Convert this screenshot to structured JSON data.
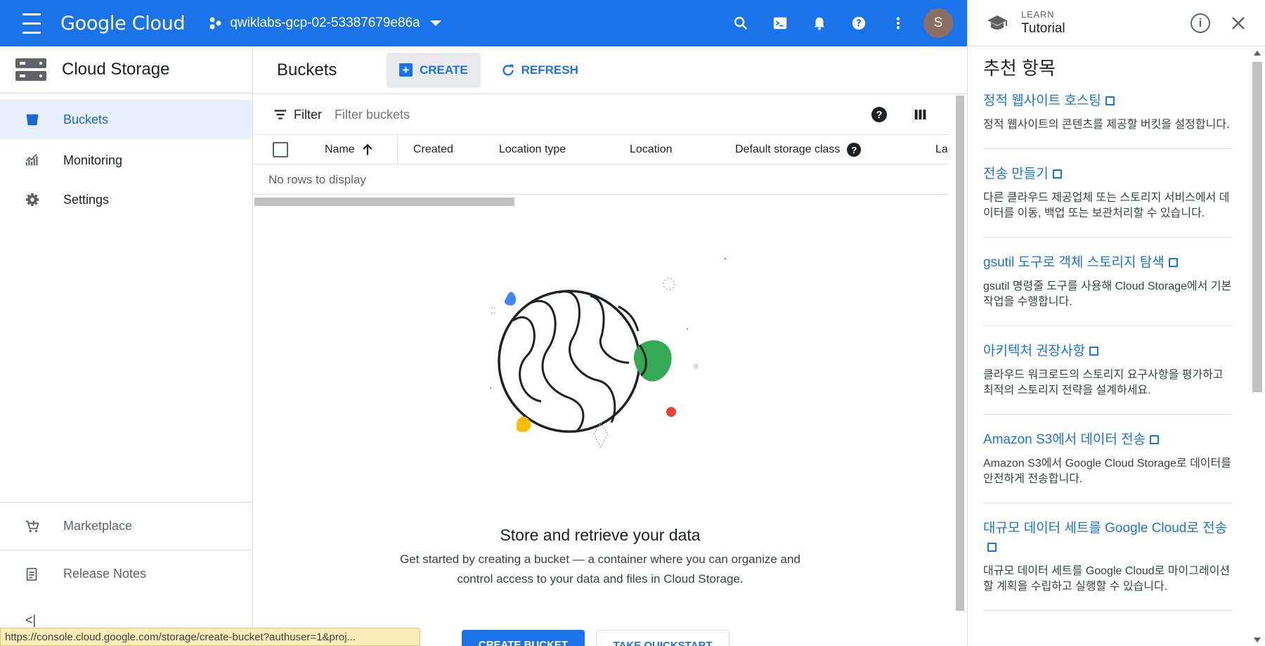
{
  "topbar": {
    "logo": "Google Cloud",
    "project": "qwiklabs-gcp-02-53387679e86a",
    "avatar_initial": "S",
    "bar_color": "#1a73e8"
  },
  "leftnav": {
    "product_title": "Cloud Storage",
    "items": [
      {
        "label": "Buckets",
        "icon": "bucket-icon",
        "active": true
      },
      {
        "label": "Monitoring",
        "icon": "monitoring-icon"
      },
      {
        "label": "Settings",
        "icon": "gear-icon"
      }
    ],
    "bottom_items": [
      {
        "label": "Marketplace",
        "icon": "marketplace-cart-icon"
      },
      {
        "label": "Release Notes",
        "icon": "release-notes-icon"
      }
    ],
    "collapse_glyph": "<|"
  },
  "main": {
    "page_title": "Buckets",
    "create_label": "CREATE",
    "refresh_label": "REFRESH",
    "filter_label": "Filter",
    "filter_placeholder": "Filter buckets",
    "columns": [
      "Name",
      "Created",
      "Location type",
      "Location",
      "Default storage class",
      "La"
    ],
    "no_rows": "No rows to display",
    "empty_title": "Store and retrieve your data",
    "empty_desc_line1": "Get started by creating a bucket — a container where you can organize and",
    "empty_desc_line2": "control access to your data and files in Cloud Storage.",
    "create_bucket_label": "CREATE BUCKET",
    "quickstart_label": "TAKE QUICKSTART"
  },
  "status_url": "https://console.cloud.google.com/storage/create-bucket?authuser=1&proj...",
  "rpanel": {
    "learn_label": "LEARN",
    "tutorial_label": "Tutorial",
    "section_title": "추천 항목",
    "recommendations": [
      {
        "title": "정적 웹사이트 호스팅",
        "desc": "정적 웹사이트의 콘텐츠를 제공할 버킷을 설정합니다."
      },
      {
        "title": "전송 만들기",
        "desc": "다른 클라우드 제공업체 또는 스토리지 서비스에서 데이터를 이동, 백업 또는 보관처리할 수 있습니다."
      },
      {
        "title": "gsutil 도구로 객체 스토리지 탐색",
        "desc": "gsutil 명령줄 도구를 사용해 Cloud Storage에서 기본 작업을 수행합니다."
      },
      {
        "title": "아키텍처 권장사항",
        "desc": "클라우드 워크로드의 스토리지 요구사항을 평가하고 최적의 스토리지 전략을 설계하세요."
      },
      {
        "title": "Amazon S3에서 데이터 전송",
        "desc": "Amazon S3에서 Google Cloud Storage로 데이터를 안전하게 전송합니다."
      },
      {
        "title": "대규모 데이터 세트를 Google Cloud로 전송",
        "desc": "대규모 데이터 세트를 Google Cloud로 마이그레이션할 계획을 수립하고 실행할 수 있습니다."
      }
    ]
  }
}
